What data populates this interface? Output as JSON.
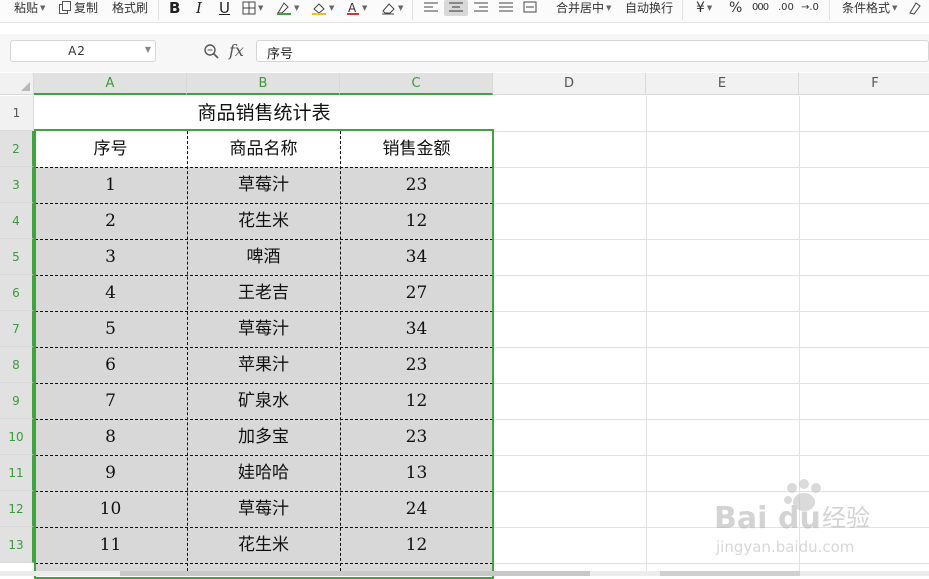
{
  "toolbar": {
    "paste_label": "粘贴",
    "copy_label": "复制",
    "format_painter_label": "格式刷",
    "merge_center_label": "合并居中",
    "wrap_text_label": "自动换行",
    "currency_symbol": "¥",
    "percent_symbol": "%",
    "decrease_decimal_label": ".00",
    "increase_decimal_label": "→.0",
    "conditional_format_label": "条件格式"
  },
  "formula_bar": {
    "cell_reference": "A2",
    "fx_label": "fx",
    "formula_value": "序号"
  },
  "sheet": {
    "column_headers": [
      "A",
      "B",
      "C",
      "D",
      "E",
      "F"
    ],
    "row_numbers": [
      "1",
      "2",
      "3",
      "4",
      "5",
      "6",
      "7",
      "8",
      "9",
      "10",
      "11",
      "12",
      "13"
    ],
    "title": "商品销售统计表",
    "table_headers": [
      "序号",
      "商品名称",
      "销售金额"
    ],
    "rows": [
      [
        "1",
        "草莓汁",
        "23"
      ],
      [
        "2",
        "花生米",
        "12"
      ],
      [
        "3",
        "啤酒",
        "34"
      ],
      [
        "4",
        "王老吉",
        "27"
      ],
      [
        "5",
        "草莓汁",
        "34"
      ],
      [
        "6",
        "苹果汁",
        "23"
      ],
      [
        "7",
        "矿泉水",
        "12"
      ],
      [
        "8",
        "加多宝",
        "23"
      ],
      [
        "9",
        "娃哈哈",
        "13"
      ],
      [
        "10",
        "草莓汁",
        "24"
      ],
      [
        "11",
        "花生米",
        "12"
      ]
    ],
    "selection": "A2:C13"
  },
  "colors": {
    "selection_green": "#3fa33f",
    "data_fill": "#d8d8d8",
    "header_bg": "#f1f1f1"
  },
  "watermark": {
    "brand": "Baidu经验",
    "url": "jingyan.baidu.com"
  }
}
